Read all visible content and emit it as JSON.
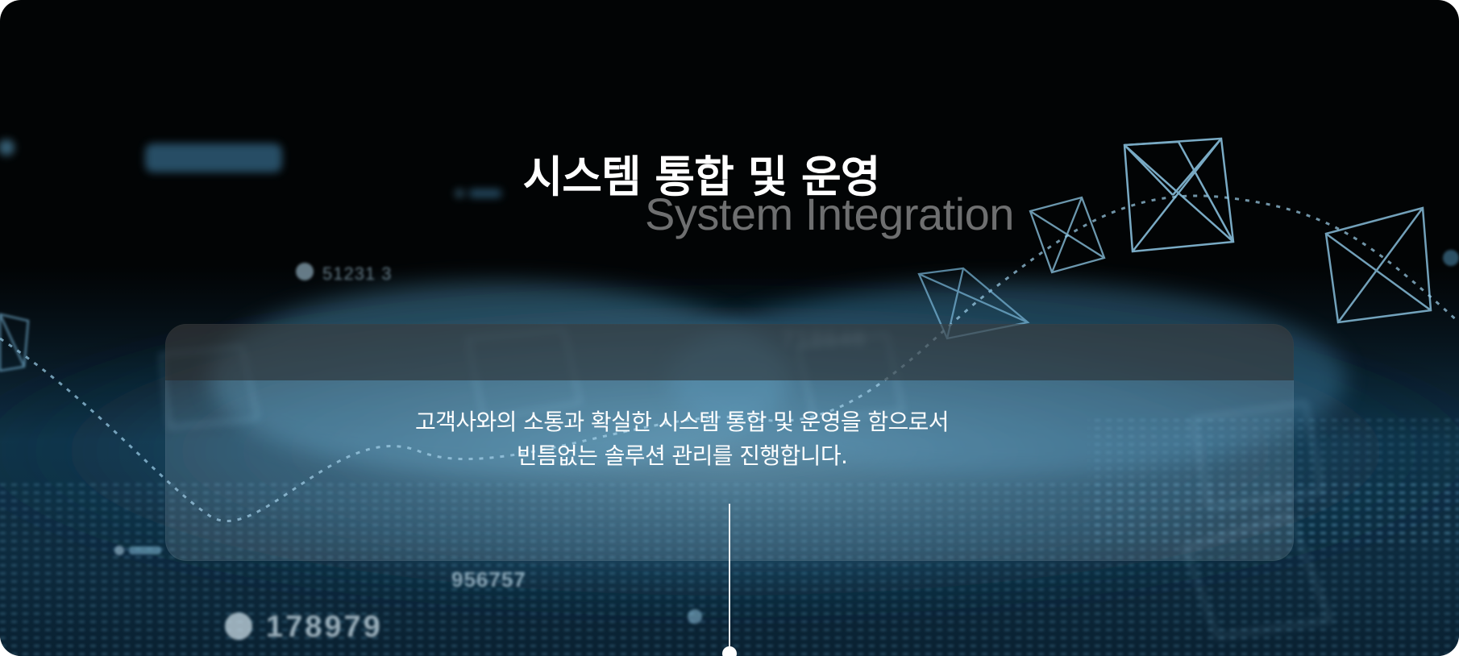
{
  "hero": {
    "title": "시스템 통합 및 운영",
    "subtitle": "System Integration",
    "description": [
      "고객사와의 소통과 확실한 시스템 통합 및 운영을 함으로서",
      "빈틈없는 솔루션 관리를 진행합니다."
    ]
  },
  "background": {
    "numbers": [
      "51231 3",
      "178979",
      "956757",
      "718646"
    ]
  },
  "colors": {
    "background": "#020405",
    "accent": "#4fa9d6",
    "text": "#ffffff"
  }
}
